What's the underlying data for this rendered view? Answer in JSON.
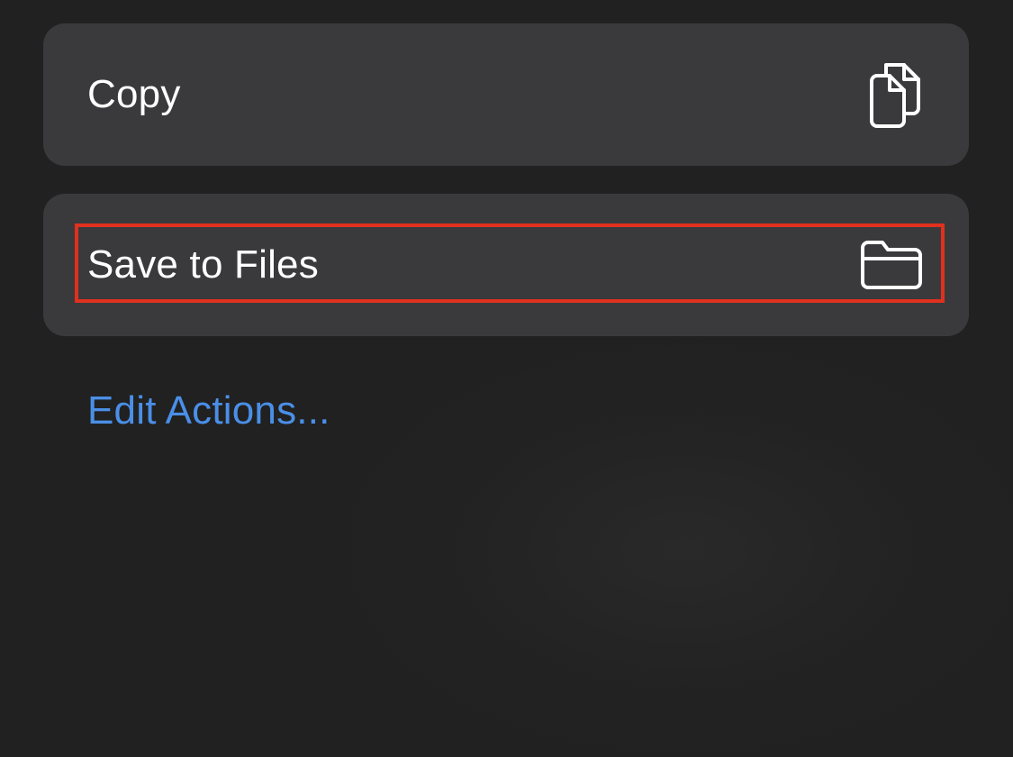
{
  "actions": [
    {
      "label": "Copy",
      "icon": "copy-icon"
    },
    {
      "label": "Save to Files",
      "icon": "folder-icon"
    }
  ],
  "edit_actions_label": "Edit Actions...",
  "colors": {
    "background": "#212121",
    "card": "#3a3a3c",
    "text": "#ffffff",
    "link": "#4a8fe7",
    "highlight": "#e0301e"
  }
}
